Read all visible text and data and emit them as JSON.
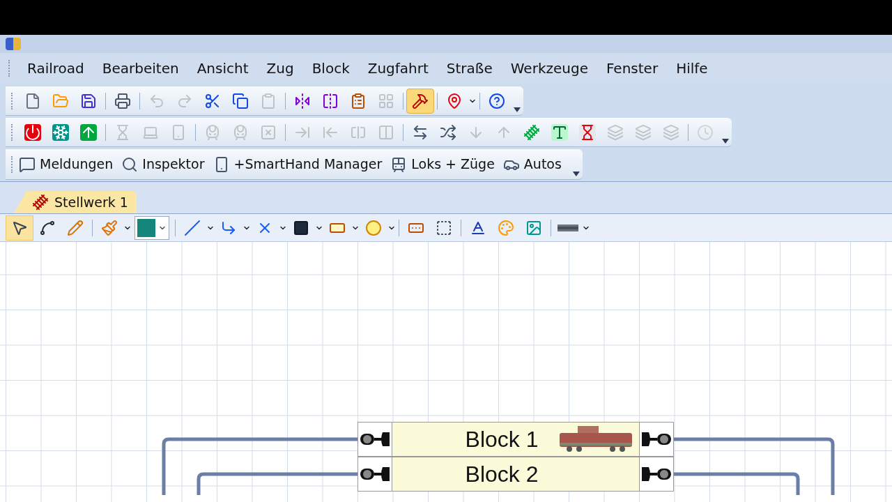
{
  "menu": [
    {
      "label": "Railroad"
    },
    {
      "label": "Bearbeiten"
    },
    {
      "label": "Ansicht"
    },
    {
      "label": "Zug"
    },
    {
      "label": "Block"
    },
    {
      "label": "Zugfahrt"
    },
    {
      "label": "Straße"
    },
    {
      "label": "Werkzeuge"
    },
    {
      "label": "Fenster"
    },
    {
      "label": "Hilfe"
    }
  ],
  "toolbars": [
    {
      "groups": [
        [
          {
            "selected": false,
            "disabled": false
          },
          {
            "selected": false,
            "disabled": false
          },
          {
            "selected": false,
            "disabled": false
          }
        ],
        [
          {
            "selected": false,
            "disabled": false
          }
        ],
        [
          {
            "selected": false,
            "disabled": true
          },
          {
            "selected": false,
            "disabled": true
          },
          {
            "selected": false,
            "disabled": false
          },
          {
            "selected": false,
            "disabled": false
          },
          {
            "selected": false,
            "disabled": true
          }
        ],
        [
          {
            "selected": false,
            "disabled": false
          },
          {
            "selected": false,
            "disabled": false
          },
          {
            "selected": false,
            "disabled": false
          },
          {
            "selected": false,
            "disabled": true
          }
        ],
        [
          {
            "selected": true,
            "disabled": false
          }
        ],
        [
          {
            "selected": false,
            "disabled": false,
            "dropdown": true
          }
        ],
        [
          {
            "selected": false,
            "disabled": false
          }
        ]
      ]
    },
    {
      "groups": [
        [
          {
            "selected": false,
            "disabled": false
          },
          {
            "selected": false,
            "disabled": false
          },
          {
            "selected": false,
            "disabled": false
          }
        ],
        [
          {
            "selected": false,
            "disabled": true
          },
          {
            "selected": false,
            "disabled": true
          },
          {
            "selected": false,
            "disabled": true
          }
        ],
        [
          {
            "selected": false,
            "disabled": true
          },
          {
            "selected": false,
            "disabled": true
          },
          {
            "selected": false,
            "disabled": true
          }
        ],
        [
          {
            "selected": false,
            "disabled": true
          },
          {
            "selected": false,
            "disabled": true
          },
          {
            "selected": false,
            "disabled": true
          },
          {
            "selected": false,
            "disabled": true
          }
        ],
        [
          {
            "selected": false,
            "disabled": false
          },
          {
            "selected": false,
            "disabled": false
          },
          {
            "selected": false,
            "disabled": true
          },
          {
            "selected": false,
            "disabled": true
          },
          {
            "selected": false,
            "disabled": false
          },
          {
            "selected": false,
            "disabled": false
          },
          {
            "selected": false,
            "disabled": false
          },
          {
            "selected": false,
            "disabled": true
          },
          {
            "selected": false,
            "disabled": true
          },
          {
            "selected": false,
            "disabled": true
          }
        ],
        [
          {
            "selected": false,
            "disabled": true
          }
        ]
      ]
    }
  ],
  "panels": [
    {
      "label": "Meldungen"
    },
    {
      "label": "Inspektor"
    },
    {
      "label": "+SmartHand Manager"
    },
    {
      "label": "Loks + Züge"
    },
    {
      "label": "Autos"
    }
  ],
  "tabs": [
    {
      "label": "Stellwerk 1",
      "selected": true
    }
  ],
  "drawing_toolbar": {
    "groups": [
      [
        {
          "kind": "tool",
          "selected": true
        },
        {
          "kind": "tool",
          "selected": false
        },
        {
          "kind": "tool",
          "selected": false
        }
      ],
      [
        {
          "kind": "tool",
          "selected": false,
          "dropdown": true
        },
        {
          "kind": "color",
          "color": "#14877a",
          "dropdown": true
        }
      ],
      [
        {
          "kind": "tool",
          "selected": false,
          "dropdown": true
        },
        {
          "kind": "tool",
          "selected": false,
          "dropdown": true
        },
        {
          "kind": "tool",
          "selected": false,
          "dropdown": true
        },
        {
          "kind": "tool",
          "selected": false,
          "dropdown": true
        },
        {
          "kind": "tool",
          "selected": false,
          "dropdown": true
        },
        {
          "kind": "tool",
          "selected": false,
          "dropdown": true
        }
      ],
      [
        {
          "kind": "tool",
          "selected": false
        },
        {
          "kind": "tool",
          "selected": false
        }
      ],
      [
        {
          "kind": "tool",
          "selected": false
        },
        {
          "kind": "tool",
          "selected": false
        },
        {
          "kind": "tool",
          "selected": false
        }
      ],
      [
        {
          "kind": "tool",
          "selected": false,
          "dropdown": true
        }
      ]
    ]
  },
  "blocks": [
    {
      "label": "Block 1",
      "occupied": true
    },
    {
      "label": "Block 2",
      "occupied": false
    }
  ]
}
